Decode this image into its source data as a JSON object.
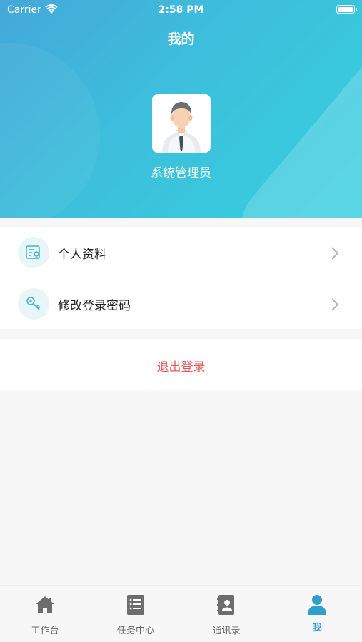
{
  "status_bar": {
    "carrier": "Carrier",
    "time": "2:58 PM"
  },
  "header": {
    "title": "我的",
    "username": "系统管理员"
  },
  "menu": {
    "items": [
      {
        "label": "个人资料",
        "icon": "profile-card-icon"
      },
      {
        "label": "修改登录密码",
        "icon": "key-icon"
      }
    ]
  },
  "logout": {
    "label": "退出登录"
  },
  "tabbar": {
    "tabs": [
      {
        "label": "工作台",
        "icon": "home-icon",
        "active": false
      },
      {
        "label": "任务中心",
        "icon": "task-list-icon",
        "active": false
      },
      {
        "label": "通讯录",
        "icon": "contacts-icon",
        "active": false
      },
      {
        "label": "我",
        "icon": "person-icon",
        "active": true
      }
    ]
  },
  "colors": {
    "header_gradient_start": "#44a8d9",
    "header_gradient_end": "#35d0de",
    "accent": "#2f9fcf",
    "logout": "#e8595a",
    "background": "#f7f7f7"
  }
}
